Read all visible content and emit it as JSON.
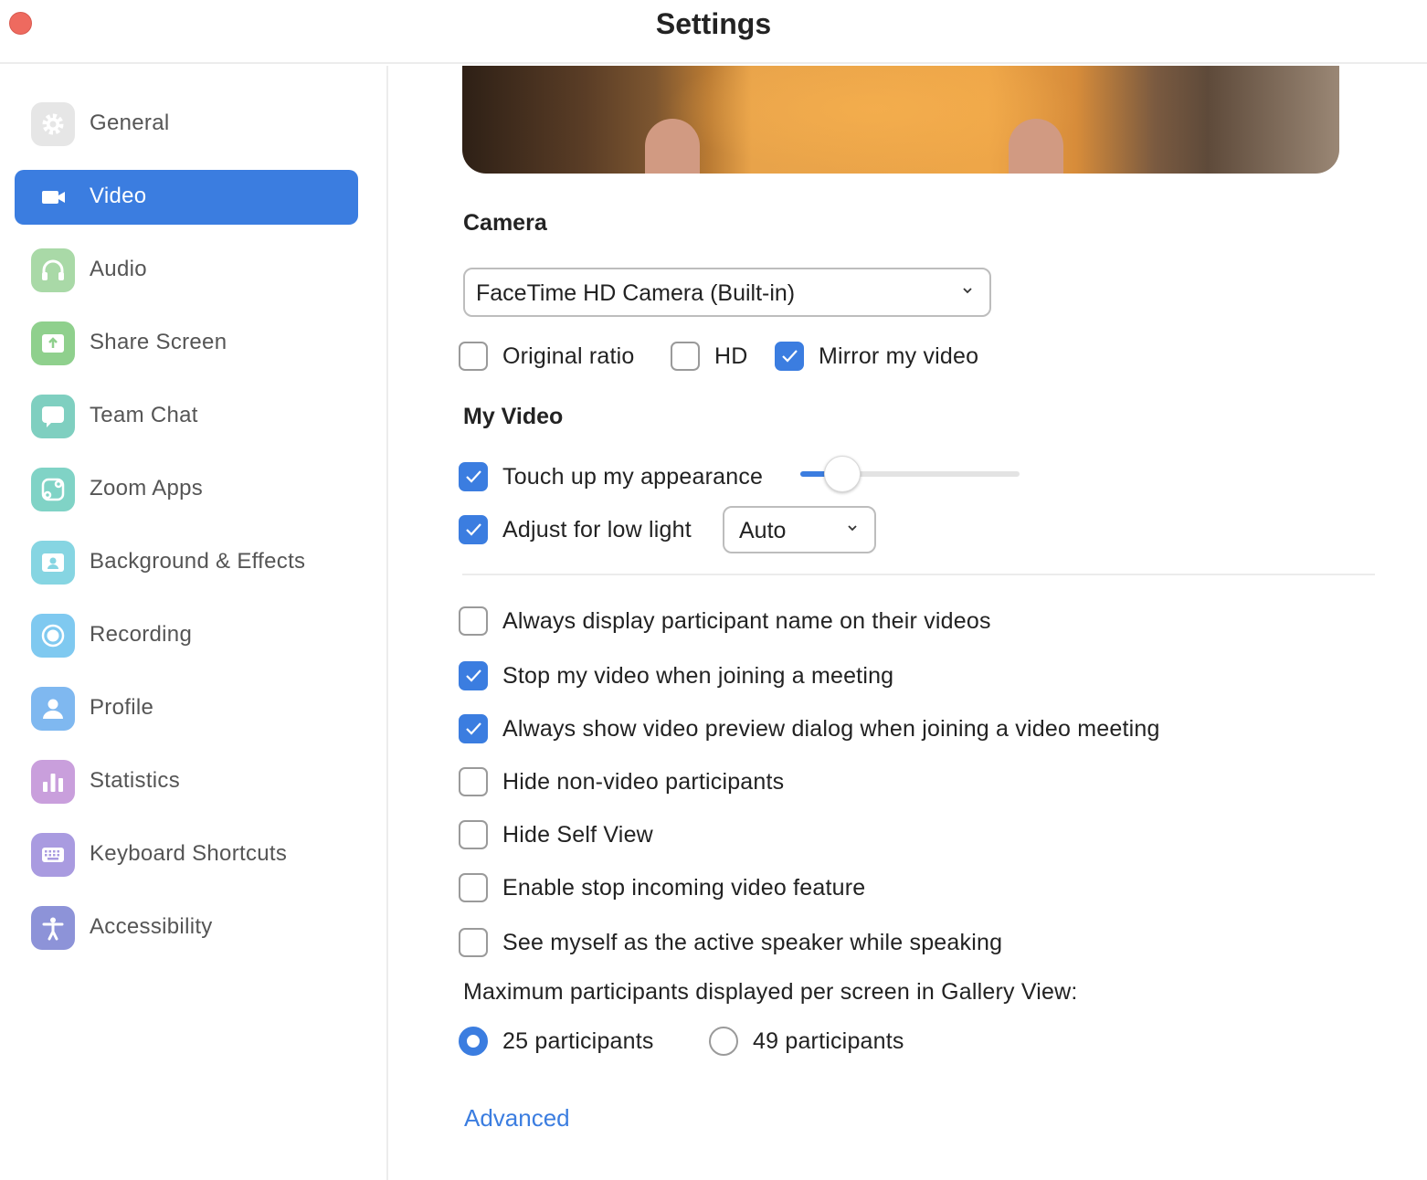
{
  "window": {
    "title": "Settings"
  },
  "sidebar": {
    "items": [
      {
        "label": "General",
        "icon": "gear-icon",
        "color": "#e6e6e6",
        "active": false
      },
      {
        "label": "Video",
        "icon": "video-camera-icon",
        "color": "#3b7de0",
        "active": true
      },
      {
        "label": "Audio",
        "icon": "headphones-icon",
        "color": "#a9d9a7",
        "active": false
      },
      {
        "label": "Share Screen",
        "icon": "share-screen-icon",
        "color": "#8fd08d",
        "active": false
      },
      {
        "label": "Team Chat",
        "icon": "chat-bubble-icon",
        "color": "#7fcfc0",
        "active": false
      },
      {
        "label": "Zoom Apps",
        "icon": "apps-icon",
        "color": "#80d3c6",
        "active": false
      },
      {
        "label": "Background & Effects",
        "icon": "background-person-icon",
        "color": "#86d5e2",
        "active": false
      },
      {
        "label": "Recording",
        "icon": "record-icon",
        "color": "#7fc9f0",
        "active": false
      },
      {
        "label": "Profile",
        "icon": "person-icon",
        "color": "#7fb8f0",
        "active": false
      },
      {
        "label": "Statistics",
        "icon": "bar-chart-icon",
        "color": "#c99fdc",
        "active": false
      },
      {
        "label": "Keyboard Shortcuts",
        "icon": "keyboard-icon",
        "color": "#a99be0",
        "active": false
      },
      {
        "label": "Accessibility",
        "icon": "accessibility-icon",
        "color": "#8d93d8",
        "active": false
      }
    ]
  },
  "camera": {
    "section_title": "Camera",
    "device": "FaceTime HD Camera (Built-in)",
    "options": [
      {
        "label": "Original ratio",
        "checked": false
      },
      {
        "label": "HD",
        "checked": false
      },
      {
        "label": "Mirror my video",
        "checked": true
      }
    ]
  },
  "my_video": {
    "section_title": "My Video",
    "touch_up": {
      "label": "Touch up my appearance",
      "checked": true,
      "slider_level": 0.19
    },
    "low_light": {
      "label": "Adjust for low light",
      "checked": true,
      "mode": "Auto"
    }
  },
  "options": [
    {
      "label": "Always display participant name on their videos",
      "checked": false
    },
    {
      "label": "Stop my video when joining a meeting",
      "checked": true
    },
    {
      "label": "Always show video preview dialog when joining a video meeting",
      "checked": true
    },
    {
      "label": "Hide non-video participants",
      "checked": false
    },
    {
      "label": "Hide Self View",
      "checked": false
    },
    {
      "label": "Enable stop incoming video feature",
      "checked": false
    },
    {
      "label": "See myself as the active speaker while speaking",
      "checked": false
    }
  ],
  "gallery": {
    "label": "Maximum participants displayed per screen in Gallery View:",
    "choices": [
      {
        "label": "25 participants",
        "selected": true
      },
      {
        "label": "49 participants",
        "selected": false
      }
    ]
  },
  "advanced_link": "Advanced",
  "colors": {
    "accent": "#3b7de0",
    "close": "#ee6a5f"
  }
}
